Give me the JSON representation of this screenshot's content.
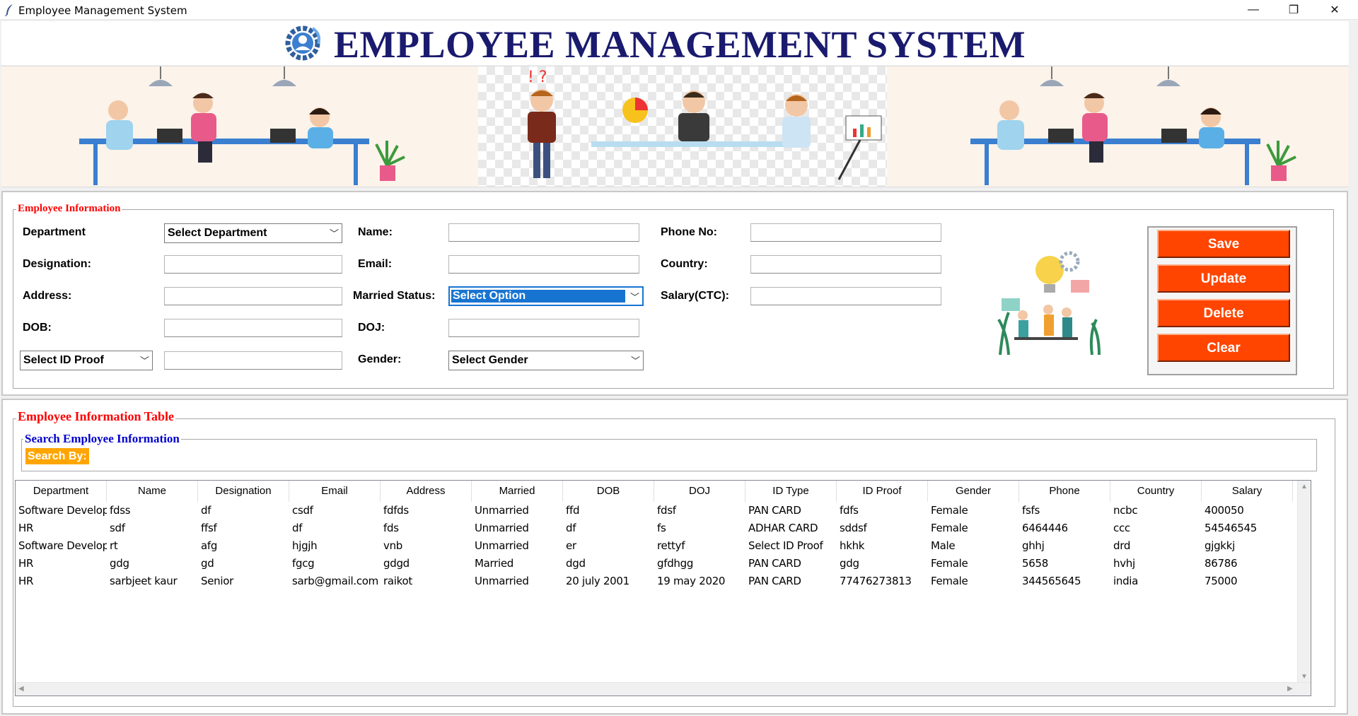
{
  "window": {
    "title": "Employee Management System",
    "minimize_glyph": "—",
    "restore_glyph": "❐",
    "close_glyph": "✕"
  },
  "header": {
    "title": "EMPLOYEE MANAGEMENT SYSTEM",
    "logo_icon": "gear-user-icon"
  },
  "banner": {
    "left_image": "office-team-illustration",
    "center_image": "business-meeting-illustration",
    "right_image": "office-team-illustration"
  },
  "form": {
    "legend": "Employee Information",
    "department": {
      "label": "Department",
      "value": "Select Department"
    },
    "designation": {
      "label": "Designation:",
      "value": ""
    },
    "address": {
      "label": "Address:",
      "value": ""
    },
    "dob": {
      "label": "DOB:",
      "value": ""
    },
    "id_proof": {
      "value": "Select ID Proof",
      "input_value": ""
    },
    "name": {
      "label": "Name:",
      "value": ""
    },
    "email": {
      "label": "Email:",
      "value": ""
    },
    "married": {
      "label": "Married Status:",
      "value": "Select Option"
    },
    "doj": {
      "label": "DOJ:",
      "value": ""
    },
    "gender": {
      "label": "Gender:",
      "value": "Select Gender"
    },
    "phone": {
      "label": "Phone No:",
      "value": ""
    },
    "country": {
      "label": "Country:",
      "value": ""
    },
    "salary": {
      "label": "Salary(CTC):",
      "value": ""
    },
    "illustration": "idea-team-illustration"
  },
  "buttons": {
    "save": "Save",
    "update": "Update",
    "delete": "Delete",
    "clear": "Clear"
  },
  "table_section": {
    "legend": "Employee Information Table",
    "search_legend": "Search Employee Information",
    "search_by": "Search By:",
    "columns": [
      "Department",
      "Name",
      "Designation",
      "Email",
      "Address",
      "Married",
      "DOB",
      "DOJ",
      "ID Type",
      "ID Proof",
      "Gender",
      "Phone",
      "Country",
      "Salary"
    ],
    "rows": [
      [
        "Software Developer",
        "fdss",
        "df",
        "csdf",
        "fdfds",
        "Unmarried",
        "ffd",
        "fdsf",
        "PAN CARD",
        "fdfs",
        "Female",
        "fsfs",
        "ncbc",
        "400050"
      ],
      [
        "HR",
        "sdf",
        "ffsf",
        "df",
        "fds",
        "Unmarried",
        "df",
        "fs",
        "ADHAR CARD",
        "sddsf",
        "Female",
        "6464446",
        "ccc",
        "54546545"
      ],
      [
        "Software Developer",
        "rt",
        "afg",
        "hjgjh",
        "vnb",
        "Unmarried",
        "er",
        "rettyf",
        "Select ID Proof",
        "hkhk",
        "Male",
        "ghhj",
        "drd",
        "gjgkkj"
      ],
      [
        "HR",
        "gdg",
        "gd",
        "fgcg",
        "gdgd",
        "Married",
        "dgd",
        "gfdhgg",
        "PAN CARD",
        "gdg",
        "Female",
        "5658",
        "hvhj",
        "86786"
      ],
      [
        "HR",
        "sarbjeet kaur",
        "Senior",
        "sarb@gmail.com",
        "raikot",
        "Unmarried",
        "20 july 2001",
        "19 may 2020",
        "PAN CARD",
        "77476273813",
        "Female",
        "344565645",
        "india",
        "75000"
      ]
    ]
  },
  "colors": {
    "title_navy": "#1a1a6e",
    "button_orange": "#ff4500",
    "legend_red": "#ff0000",
    "legend_blue": "#0000cc",
    "search_orange": "#ffa500",
    "selection_blue": "#1874d1"
  }
}
